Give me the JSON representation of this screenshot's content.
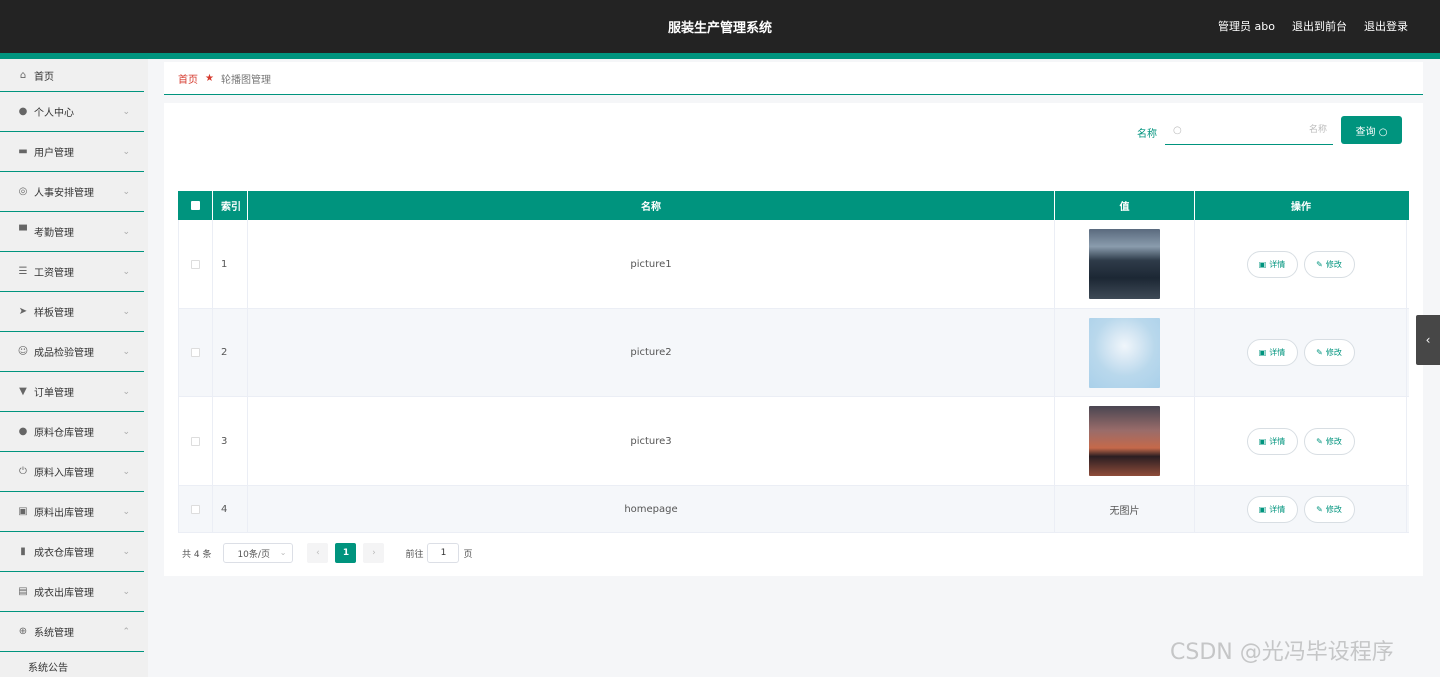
{
  "header": {
    "title": "服装生产管理系统",
    "user": "管理员 abo",
    "to_front": "退出到前台",
    "logout": "退出登录"
  },
  "sidebar": {
    "items": [
      {
        "label": "首页",
        "icon": "home-icon"
      },
      {
        "label": "个人中心",
        "icon": "user-icon"
      },
      {
        "label": "用户管理",
        "icon": "users-icon"
      },
      {
        "label": "人事安排管理",
        "icon": "gauge-icon"
      },
      {
        "label": "考勤管理",
        "icon": "chat-icon"
      },
      {
        "label": "工资管理",
        "icon": "list-icon"
      },
      {
        "label": "样板管理",
        "icon": "send-icon"
      },
      {
        "label": "成品检验管理",
        "icon": "smile-icon"
      },
      {
        "label": "订单管理",
        "icon": "pin-icon"
      },
      {
        "label": "原料仓库管理",
        "icon": "person-icon"
      },
      {
        "label": "原料入库管理",
        "icon": "power-icon"
      },
      {
        "label": "原料出库管理",
        "icon": "trash-icon"
      },
      {
        "label": "成衣仓库管理",
        "icon": "bar-chart-icon"
      },
      {
        "label": "成衣出库管理",
        "icon": "clipboard-icon"
      },
      {
        "label": "系统管理",
        "icon": "compass-icon"
      }
    ],
    "submenu": [
      "系统公告"
    ]
  },
  "breadcrumb": {
    "home": "首页",
    "current": "轮播图管理"
  },
  "search": {
    "label": "名称",
    "placeholder": "名称",
    "value": "",
    "button": "查询"
  },
  "table": {
    "columns": [
      "索引",
      "名称",
      "值",
      "操作"
    ],
    "rows": [
      {
        "index": "1",
        "name": "picture1",
        "value": ""
      },
      {
        "index": "2",
        "name": "picture2",
        "value": ""
      },
      {
        "index": "3",
        "name": "picture3",
        "value": ""
      },
      {
        "index": "4",
        "name": "homepage",
        "value": "无图片"
      }
    ],
    "detail_label": "详情",
    "edit_label": "修改"
  },
  "pagination": {
    "total": "共 4 条",
    "page_size": "10条/页",
    "current_page": "1",
    "goto_label": "前往",
    "goto_value": "1",
    "page_suffix": "页"
  },
  "watermark": "CSDN @光冯毕设程序",
  "colors": {
    "accent": "#00947e",
    "header": "#232323",
    "breadcrumb_home": "#d63b2f"
  }
}
